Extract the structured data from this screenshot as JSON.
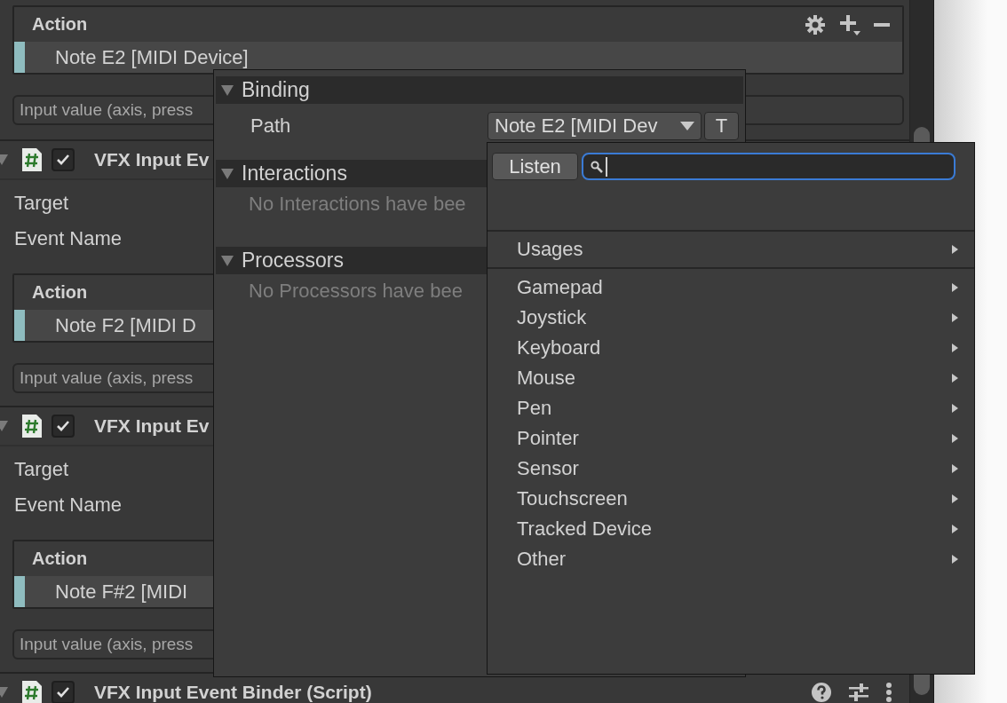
{
  "inspector": {
    "top": {
      "action_list": {
        "header": "Action",
        "items": [
          {
            "label": "Note E2 [MIDI Device]"
          }
        ]
      },
      "info_box": "Input value (axis, press"
    },
    "components": [
      {
        "title": "VFX Input Ev",
        "enabled": true,
        "fields": [
          {
            "label": "Target"
          },
          {
            "label": "Event Name"
          }
        ],
        "action_list": {
          "header": "Action",
          "items": [
            {
              "label": "Note F2 [MIDI D"
            }
          ]
        },
        "info_box": "Input value (axis, press"
      },
      {
        "title": "VFX Input Ev",
        "enabled": true,
        "fields": [
          {
            "label": "Target"
          },
          {
            "label": "Event Name"
          }
        ],
        "action_list": {
          "header": "Action",
          "items": [
            {
              "label": "Note F#2 [MIDI"
            }
          ]
        },
        "info_box": "Input value (axis, press"
      },
      {
        "title": "VFX Input Event Binder (Script)",
        "enabled": true
      }
    ]
  },
  "binding_popup": {
    "sections": [
      {
        "title": "Binding",
        "expanded": true,
        "kind": "path",
        "label": "Path",
        "value": "Note E2 [MIDI Dev",
        "toggle": "T"
      },
      {
        "title": "Interactions",
        "expanded": true,
        "kind": "message",
        "message": "No Interactions have bee"
      },
      {
        "title": "Processors",
        "expanded": true,
        "kind": "message",
        "message": "No Processors have bee"
      }
    ]
  },
  "control_picker": {
    "listen_button": "Listen",
    "groups": [
      {
        "items": [
          {
            "label": "Usages",
            "submenu": true
          }
        ]
      },
      {
        "items": [
          {
            "label": "Gamepad",
            "submenu": true
          },
          {
            "label": "Joystick",
            "submenu": true
          },
          {
            "label": "Keyboard",
            "submenu": true
          },
          {
            "label": "Mouse",
            "submenu": true
          },
          {
            "label": "Pen",
            "submenu": true
          },
          {
            "label": "Pointer",
            "submenu": true
          },
          {
            "label": "Sensor",
            "submenu": true
          },
          {
            "label": "Touchscreen",
            "submenu": true
          },
          {
            "label": "Tracked Device",
            "submenu": true
          },
          {
            "label": "Other",
            "submenu": true
          }
        ]
      }
    ]
  }
}
